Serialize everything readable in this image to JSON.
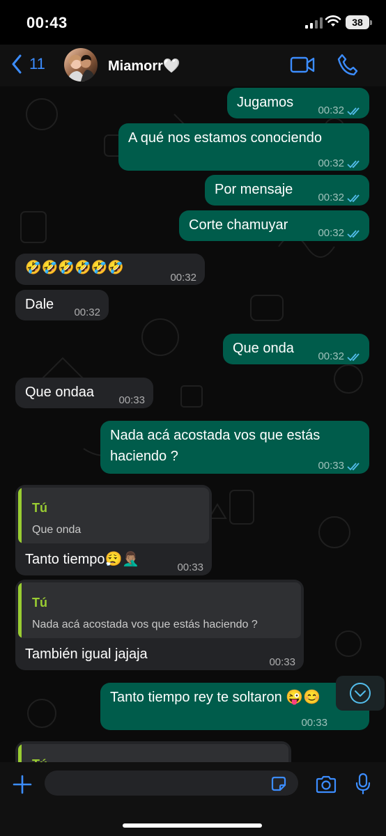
{
  "status": {
    "time": "00:43",
    "battery": "38"
  },
  "header": {
    "back_count": "11",
    "contact_name": "Miamorr🤍"
  },
  "messages": [
    {
      "text": "Jugamos",
      "time": "00:32"
    },
    {
      "text": "A qué nos estamos conociendo",
      "time": "00:32"
    },
    {
      "text": "Por mensaje",
      "time": "00:32"
    },
    {
      "text": "Corte chamuyar",
      "time": "00:32"
    },
    {
      "text": "🤣🤣🤣🤣🤣🤣",
      "time": "00:32"
    },
    {
      "text": "Dale",
      "time": "00:32"
    },
    {
      "text": "Que onda",
      "time": "00:32"
    },
    {
      "text": "Que ondaa",
      "time": "00:33"
    },
    {
      "text": "Nada acá acostada vos que estás",
      "text2": "haciendo ?",
      "time": "00:33"
    },
    {
      "text": "Tanto tiempo😮‍💨🤦🏽‍♂️",
      "time": "00:33",
      "quote_name": "Tú",
      "quote_text": "Que onda"
    },
    {
      "text": "También igual jajaja",
      "time": "00:33",
      "quote_name": "Tú",
      "quote_text": "Nada acá acostada vos que estás haciendo ?"
    },
    {
      "text": "Tanto tiempo rey te soltaron 😜😊",
      "time": "00:33"
    },
    {
      "quote_name": "Tú"
    }
  ],
  "colors": {
    "outgoing": "#005c4b",
    "incoming": "#232427",
    "accent": "#3c8dff",
    "quote_accent": "#9acd32",
    "read_ticks": "#53bdeb"
  }
}
